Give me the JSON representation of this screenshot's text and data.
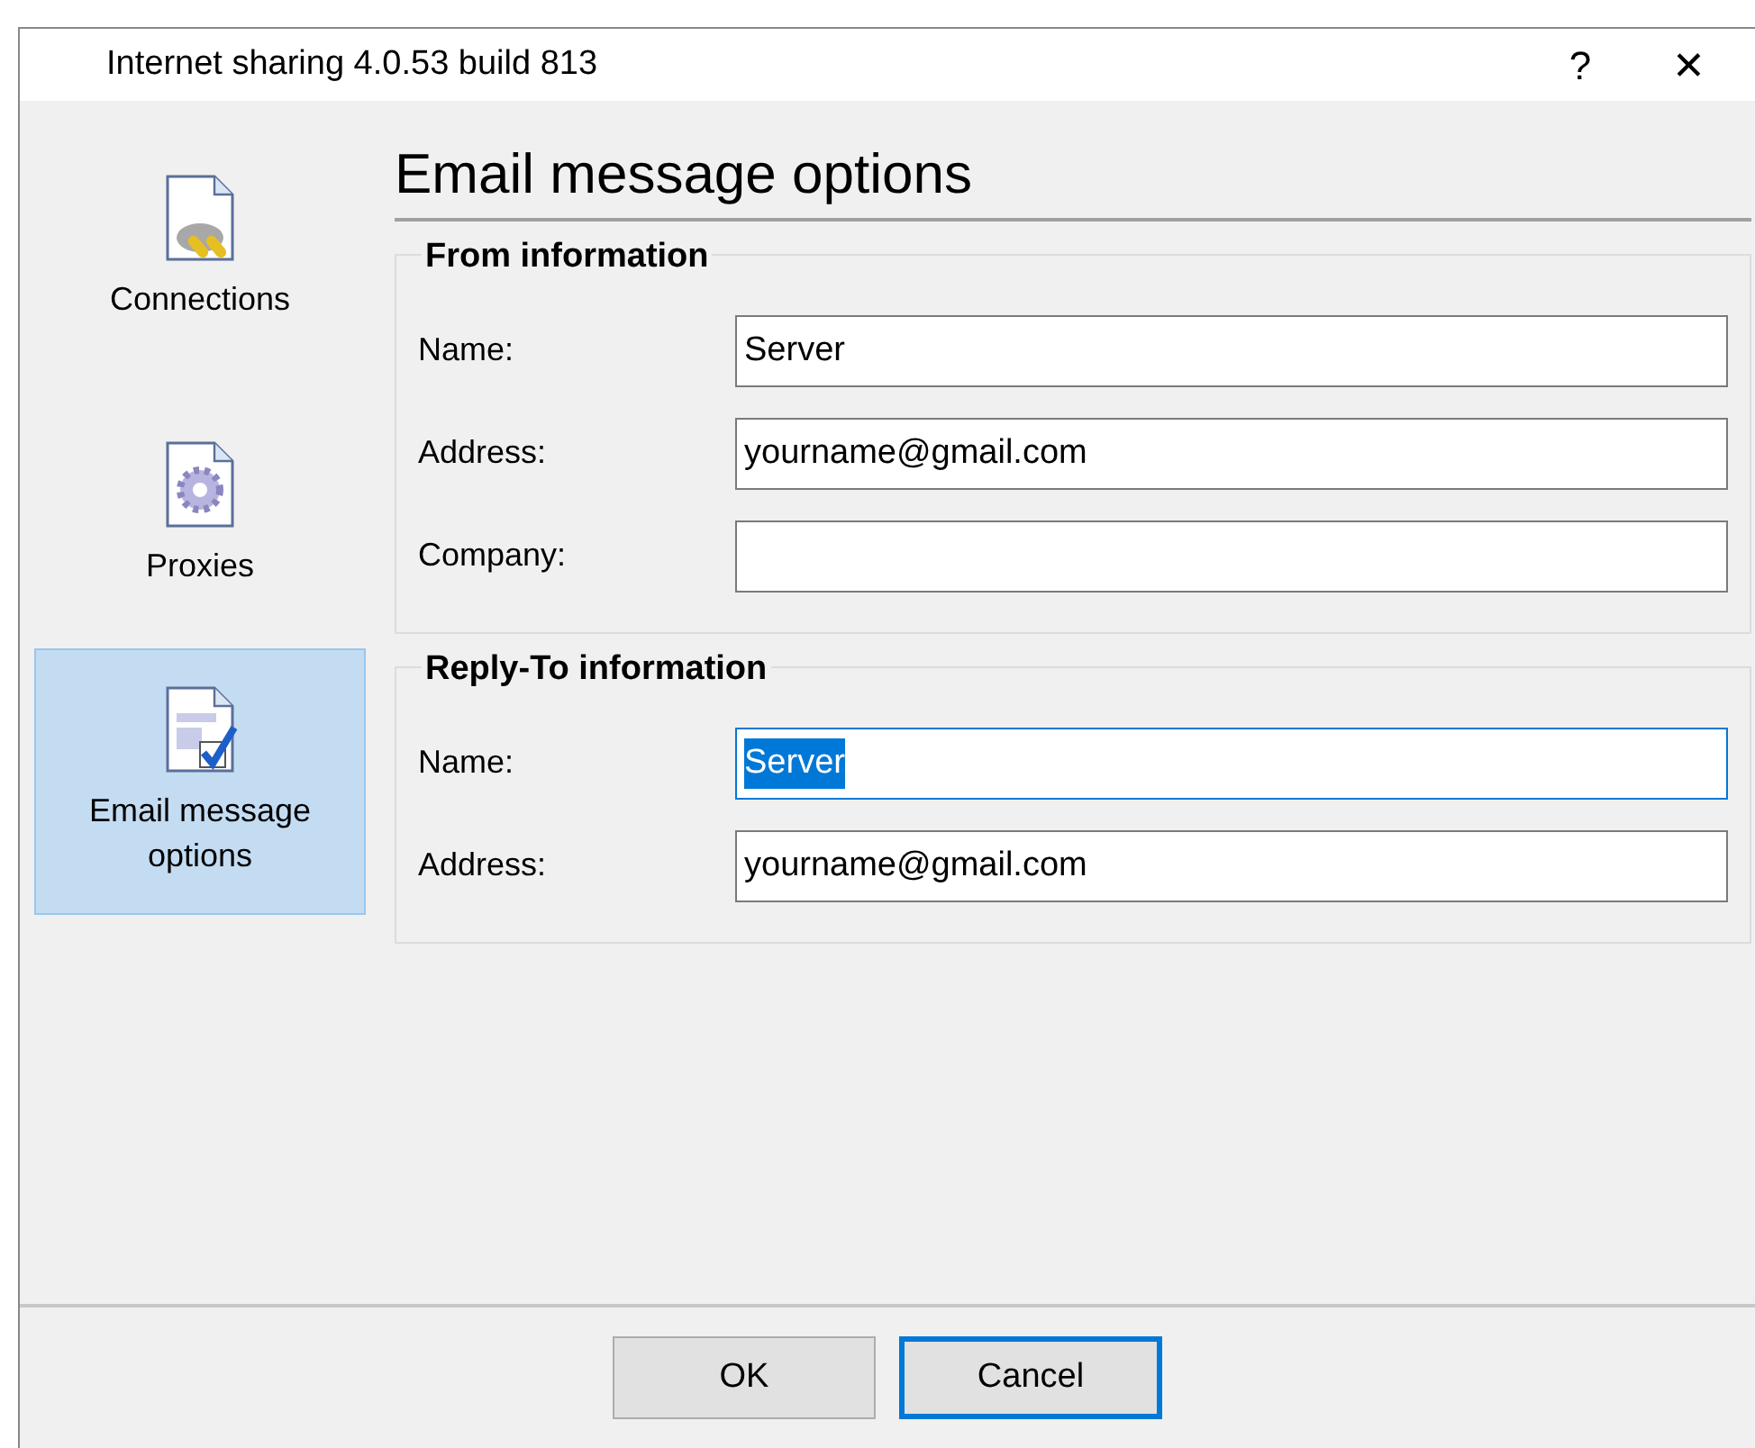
{
  "window": {
    "title": "Internet sharing 4.0.53 build 813",
    "help": "?",
    "close": "✕"
  },
  "sidebar": {
    "items": [
      {
        "label": "Connections",
        "kind": "plug",
        "selected": false
      },
      {
        "label": "Proxies",
        "kind": "gear",
        "selected": false
      },
      {
        "label": "Email message options",
        "kind": "check",
        "selected": true
      }
    ]
  },
  "page_title": "Email message options",
  "groups": [
    {
      "title": "From information",
      "fields": [
        {
          "label": "Name:",
          "value": "Server",
          "focused": false
        },
        {
          "label": "Address:",
          "value": "yourname@gmail.com",
          "focused": false
        },
        {
          "label": "Company:",
          "focused": false
        }
      ]
    },
    {
      "title": "Reply-To information",
      "fields": [
        {
          "label": "Name:",
          "value": "Server",
          "focused": true
        },
        {
          "label": "Address:",
          "value": "yourname@gmail.com",
          "focused": false
        }
      ]
    }
  ],
  "buttons": [
    {
      "label": "OK",
      "focused": false
    },
    {
      "label": "Cancel",
      "focused": true
    }
  ]
}
